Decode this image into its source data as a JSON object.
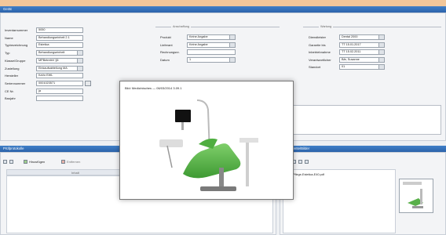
{
  "app": {
    "window_title": "Gerät",
    "accent": "#2c63aa",
    "banner_color": "#f2c79a"
  },
  "form": {
    "left": [
      {
        "label": "Inventarnummer",
        "value": "5050",
        "kind": "text"
      },
      {
        "label": "Name",
        "value": "Behandlungseinheit 2.1",
        "kind": "text"
      },
      {
        "label": "Typbezeichnung",
        "value": "Estetica",
        "kind": "text"
      },
      {
        "label": "Typ",
        "value": "Behandlungseinheit",
        "kind": "select"
      },
      {
        "label": "Klasse/Gruppe",
        "value": "MPBetreibV §5",
        "kind": "select"
      },
      {
        "label": "Zustellung",
        "value": "Einkaufsabteilung MA",
        "kind": "select"
      },
      {
        "label": "Hersteller",
        "value": "KaVo EWL",
        "kind": "text"
      },
      {
        "label": "Seriennummer",
        "value": "0001023571",
        "kind": "text"
      },
      {
        "label": "CE Nr.",
        "value": "ja",
        "kind": "text"
      },
      {
        "label": "Baujahr",
        "value": "",
        "kind": "text"
      }
    ],
    "mid_group": "Anschaffung",
    "mid": [
      {
        "label": "Produkt",
        "value": "Keine Angabe",
        "kind": "select"
      },
      {
        "label": "Lieferant",
        "value": "Keine Angabe",
        "kind": "select"
      },
      {
        "label": "Rechnungsnr.",
        "value": "",
        "kind": "text"
      },
      {
        "label": "Datum",
        "value": "1",
        "kind": "select"
      }
    ],
    "right_group": "Wartung",
    "right": [
      {
        "label": "Dienstleister",
        "value": "Dental 2000",
        "kind": "select"
      },
      {
        "label": "Garantie bis",
        "value": "TT 15.01.2017",
        "kind": "select"
      },
      {
        "label": "Inbetriebnahme",
        "value": "TT 15.02.2011",
        "kind": "select"
      },
      {
        "label": "Verantwortlicher",
        "value": "Bär, Susanne",
        "kind": "select"
      },
      {
        "label": "Standort",
        "value": "01",
        "kind": "select"
      }
    ]
  },
  "bottom_left": {
    "title": "Prüfprotokolle",
    "add_label": "Hinzufügen",
    "delete_label": "Entfernen",
    "column": "Inhalt"
  },
  "bottom_right": {
    "title": "Dokumente/Bilder",
    "file": "Pflege-Estetica-E40.pdf"
  },
  "modal": {
    "title": "Bild: Medizinisches — 06/03/2014 3.09.1"
  }
}
